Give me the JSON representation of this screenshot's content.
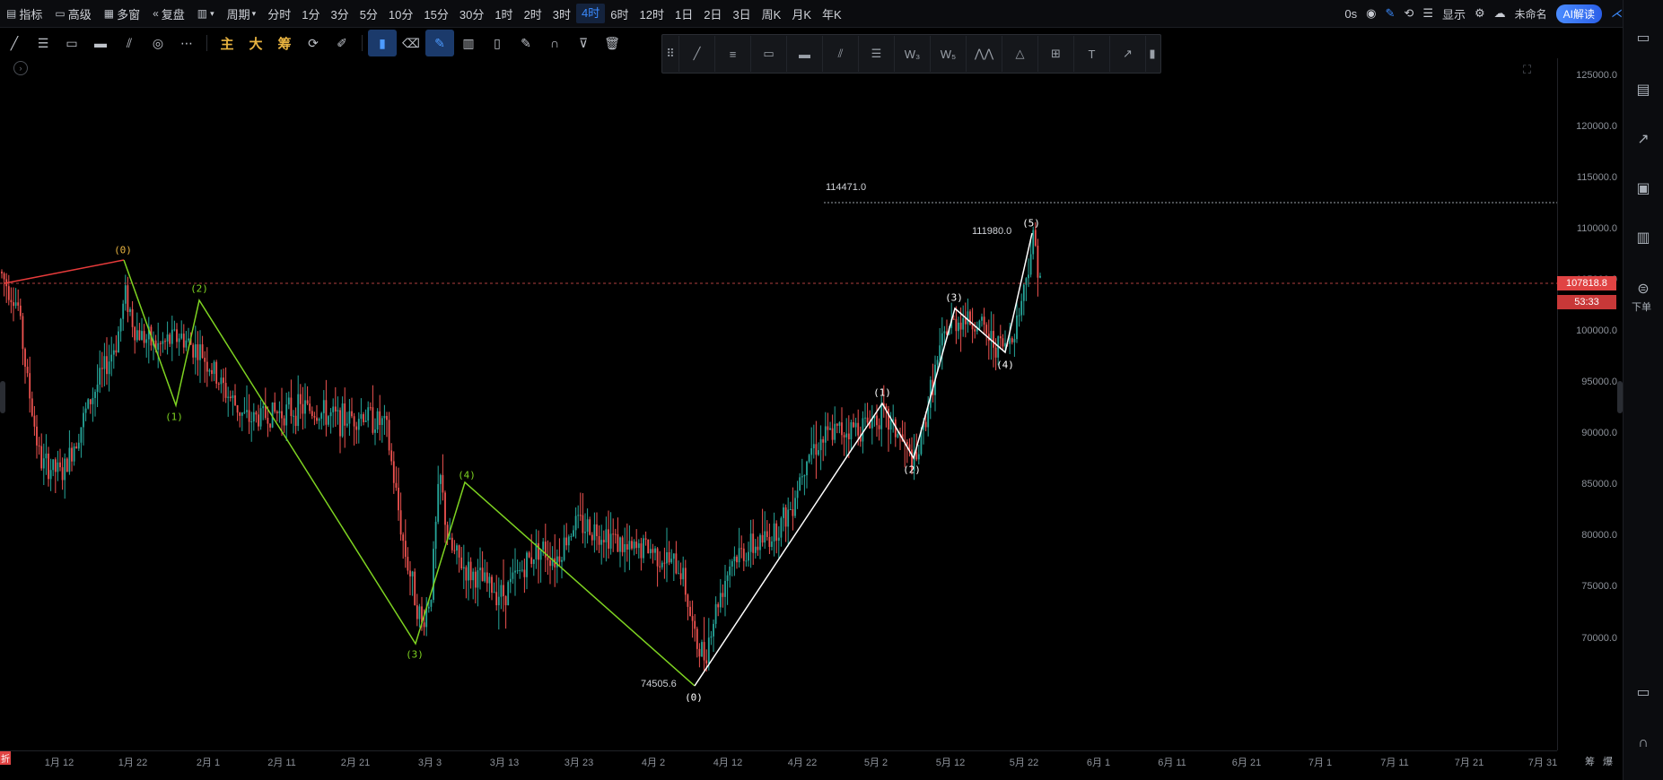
{
  "topbar": {
    "indicator": "指标",
    "advanced": "高级",
    "multiwin": "多窗",
    "replay": "复盘",
    "period": "周期",
    "periods": [
      "分时",
      "1分",
      "3分",
      "5分",
      "10分",
      "15分",
      "30分",
      "1时",
      "2时",
      "3时",
      "4时",
      "6时",
      "12时",
      "1日",
      "2日",
      "3日",
      "周K",
      "月K",
      "年K"
    ],
    "active_period": "4时",
    "countdown": "0s",
    "display": "显示",
    "unnamed": "未命名",
    "ai": "AI解读"
  },
  "toolbar": {
    "main": "主",
    "big": "大",
    "chip": "筹"
  },
  "rightpanel": {
    "order": "下单"
  },
  "price_axis": {
    "ticks": [
      "125000.0",
      "120000.0",
      "115000.0",
      "110000.0",
      "105000.0",
      "100000.0",
      "95000.0",
      "90000.0",
      "85000.0",
      "80000.0",
      "75000.0",
      "70000.0"
    ],
    "current_price": "107818.8",
    "timer": "53:33"
  },
  "time_axis": {
    "ticks": [
      "1月 12",
      "1月 22",
      "2月 1",
      "2月 11",
      "2月 21",
      "3月 3",
      "3月 13",
      "3月 23",
      "4月 2",
      "4月 12",
      "4月 22",
      "5月 2",
      "5月 12",
      "5月 22",
      "6月 1",
      "6月 11",
      "6月 21",
      "7月 1",
      "7月 11",
      "7月 21",
      "7月 31"
    ],
    "right_tail": [
      "筹",
      "爆"
    ],
    "left_tail": "折"
  },
  "annotations": {
    "high_line": "114471.0",
    "peak": "111980.0",
    "low": "74505.6"
  },
  "waves_orange": {
    "label": "(0)"
  },
  "waves_green": [
    "(1)",
    "(2)",
    "(3)",
    "(4)"
  ],
  "waves_white": [
    "(0)",
    "(1)",
    "(2)",
    "(3)",
    "(4)",
    "(5)"
  ],
  "colors": {
    "up": "#26a69a",
    "down": "#ef5350",
    "green_wave": "#7ed321",
    "white_wave": "#ffffff",
    "red_line": "#e83b3b",
    "accent": "#3b8bff"
  }
}
